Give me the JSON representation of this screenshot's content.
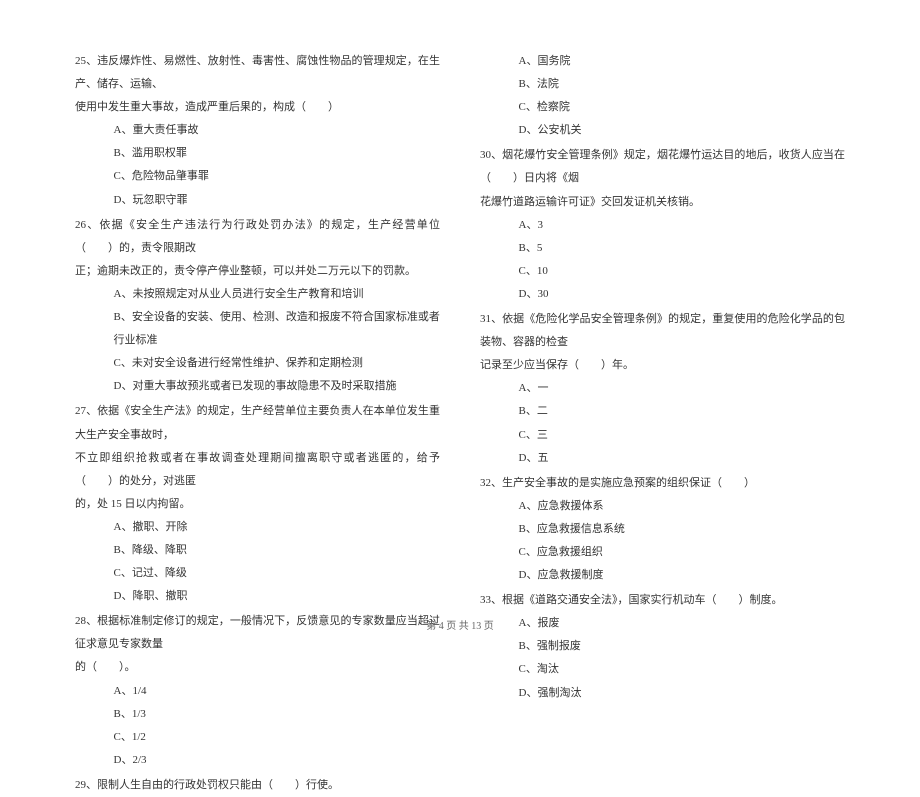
{
  "left_column": {
    "q25": {
      "line1": "25、违反爆炸性、易燃性、放射性、毒害性、腐蚀性物品的管理规定，在生产、储存、运输、",
      "line2": "使用中发生重大事故，造成严重后果的，构成（　　）",
      "optA": "A、重大责任事故",
      "optB": "B、滥用职权罪",
      "optC": "C、危险物品肇事罪",
      "optD": "D、玩忽职守罪"
    },
    "q26": {
      "line1": "26、依据《安全生产违法行为行政处罚办法》的规定，生产经营单位（　　）的，责令限期改",
      "line2": "正；逾期未改正的，责令停产停业整顿，可以并处二万元以下的罚款。",
      "optA": "A、未按照规定对从业人员进行安全生产教育和培训",
      "optB": "B、安全设备的安装、使用、检测、改造和报废不符合国家标准或者行业标准",
      "optC": "C、未对安全设备进行经常性维护、保养和定期检测",
      "optD": "D、对重大事故预兆或者已发现的事故隐患不及时采取措施"
    },
    "q27": {
      "line1": "27、依据《安全生产法》的规定，生产经营单位主要负责人在本单位发生重大生产安全事故时，",
      "line2": "不立即组织抢救或者在事故调查处理期间擅离职守或者逃匿的，给予（　　）的处分，对逃匿",
      "line3": "的，处 15 日以内拘留。",
      "optA": "A、撤职、开除",
      "optB": "B、降级、降职",
      "optC": "C、记过、降级",
      "optD": "D、降职、撤职"
    },
    "q28": {
      "line1": "28、根据标准制定修订的规定，一般情况下，反馈意见的专家数量应当超过征求意见专家数量",
      "line2": "的（　　）。",
      "optA": "A、1/4",
      "optB": "B、1/3",
      "optC": "C、1/2",
      "optD": "D、2/3"
    },
    "q29": {
      "line1": "29、限制人生自由的行政处罚权只能由（　　）行使。"
    }
  },
  "right_column": {
    "q29_opts": {
      "optA": "A、国务院",
      "optB": "B、法院",
      "optC": "C、检察院",
      "optD": "D、公安机关"
    },
    "q30": {
      "line1": "30、烟花爆竹安全管理条例》规定，烟花爆竹运达目的地后，收货人应当在（　　）日内将《烟",
      "line2": "花爆竹道路运输许可证》交回发证机关核销。",
      "optA": "A、3",
      "optB": "B、5",
      "optC": "C、10",
      "optD": "D、30"
    },
    "q31": {
      "line1": "31、依据《危险化学品安全管理条例》的规定，重复使用的危险化学品的包装物、容器的检查",
      "line2": "记录至少应当保存（　　）年。",
      "optA": "A、一",
      "optB": "B、二",
      "optC": "C、三",
      "optD": "D、五"
    },
    "q32": {
      "line1": "32、生产安全事故的是实施应急预案的组织保证（　　）",
      "optA": "A、应急救援体系",
      "optB": "B、应急救援信息系统",
      "optC": "C、应急救援组织",
      "optD": "D、应急救援制度"
    },
    "q33": {
      "line1": "33、根据《道路交通安全法》，国家实行机动车（　　）制度。",
      "optA": "A、报废",
      "optB": "B、强制报废",
      "optC": "C、淘汰",
      "optD": "D、强制淘汰"
    }
  },
  "footer": "第 4 页 共 13 页"
}
